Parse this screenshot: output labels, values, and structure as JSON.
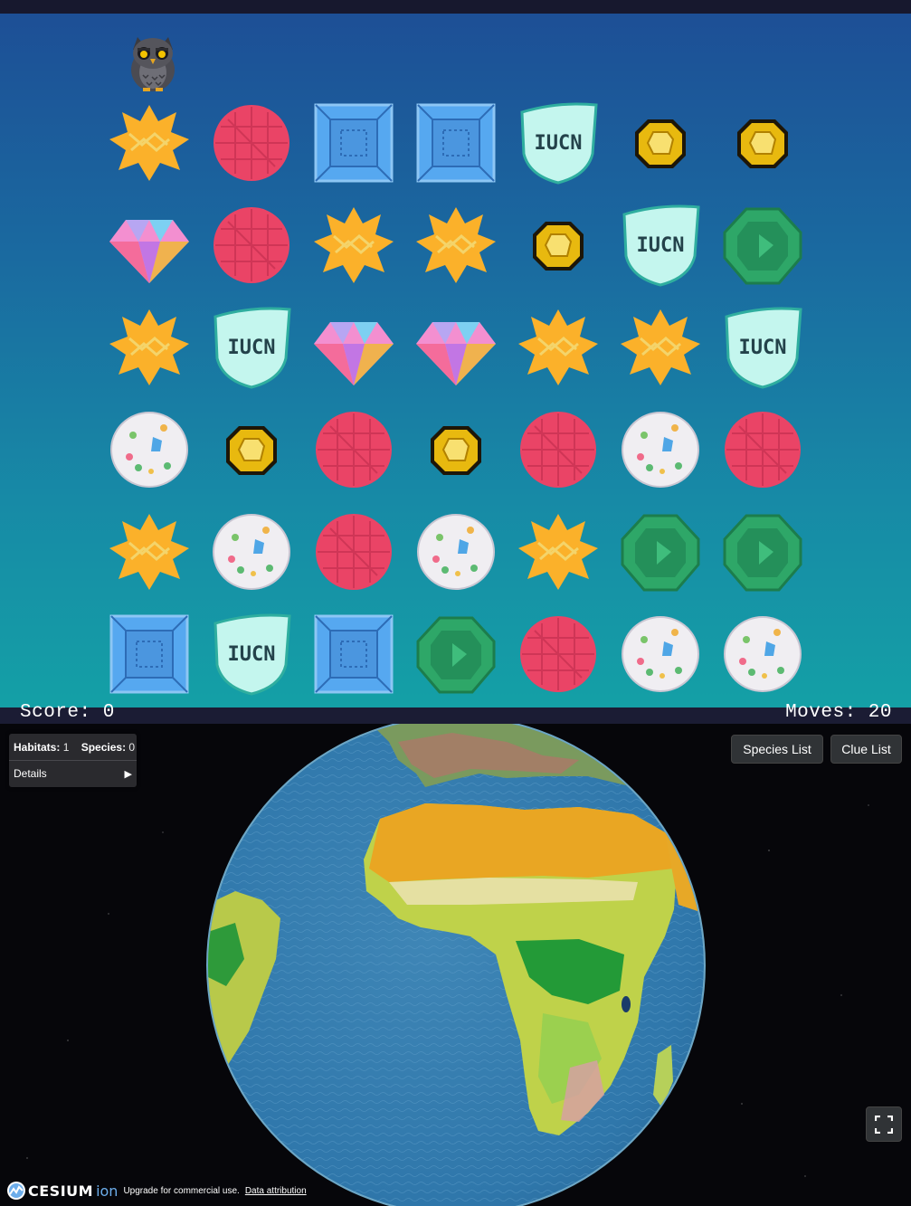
{
  "game": {
    "score_text": "Score: 0",
    "moves_text": "Moves: 20",
    "board": [
      [
        "star",
        "ball",
        "box",
        "box",
        "iucn",
        "gold",
        "gold"
      ],
      [
        "diamond",
        "ball",
        "star",
        "star",
        "gold",
        "iucn",
        "emerald"
      ],
      [
        "star",
        "iucn",
        "diamond",
        "diamond",
        "star",
        "star",
        "iucn"
      ],
      [
        "egg",
        "gold",
        "ball",
        "gold",
        "ball",
        "egg",
        "ball"
      ],
      [
        "star",
        "egg",
        "ball",
        "egg",
        "star",
        "emerald",
        "emerald"
      ],
      [
        "box",
        "iucn",
        "box",
        "emerald",
        "ball",
        "egg",
        "egg"
      ]
    ],
    "iucn_text": "IUCN",
    "colors": {
      "star": "#fbb12a",
      "ball": "#ea4466",
      "box": "#56a8f0",
      "iucn": "#c4f6ee",
      "gold": "#e8b90f",
      "diamond": "#f38fd0",
      "emerald": "#2ea768",
      "egg": "#f0eef2"
    }
  },
  "viewer": {
    "stats": {
      "habitats_label": "Habitats:",
      "habitats_value": "1",
      "species_label": "Species:",
      "species_value": "0"
    },
    "details_label": "Details",
    "details_arrow": "▶",
    "species_list_label": "Species List",
    "clue_list_label": "Clue List",
    "cesium_word": "CESIUM",
    "ion_word": "ion",
    "credit_text": "Upgrade for commercial use.",
    "credit_link": "Data attribution"
  }
}
